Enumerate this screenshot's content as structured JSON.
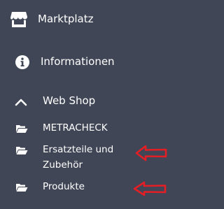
{
  "sidebar": {
    "marketplace": {
      "label": "Marktplatz",
      "icon": "store-icon"
    },
    "information": {
      "label": "Informationen",
      "icon": "info-circle-icon"
    },
    "webshop": {
      "label": "Web Shop",
      "icon": "chevron-up-icon",
      "expanded": true
    },
    "subitems": [
      {
        "label": "METRACHECK",
        "icon": "folder-open-icon"
      },
      {
        "label_line1": "Ersatzteile und",
        "label_line2": "Zubehör",
        "icon": "folder-open-icon"
      },
      {
        "label": "Produkte",
        "icon": "folder-open-icon"
      }
    ]
  },
  "annotations": {
    "arrow_color": "#e31e24",
    "arrow_icon": "left-arrow-annotation"
  },
  "colors": {
    "background": "#404656",
    "text": "#ffffff"
  }
}
